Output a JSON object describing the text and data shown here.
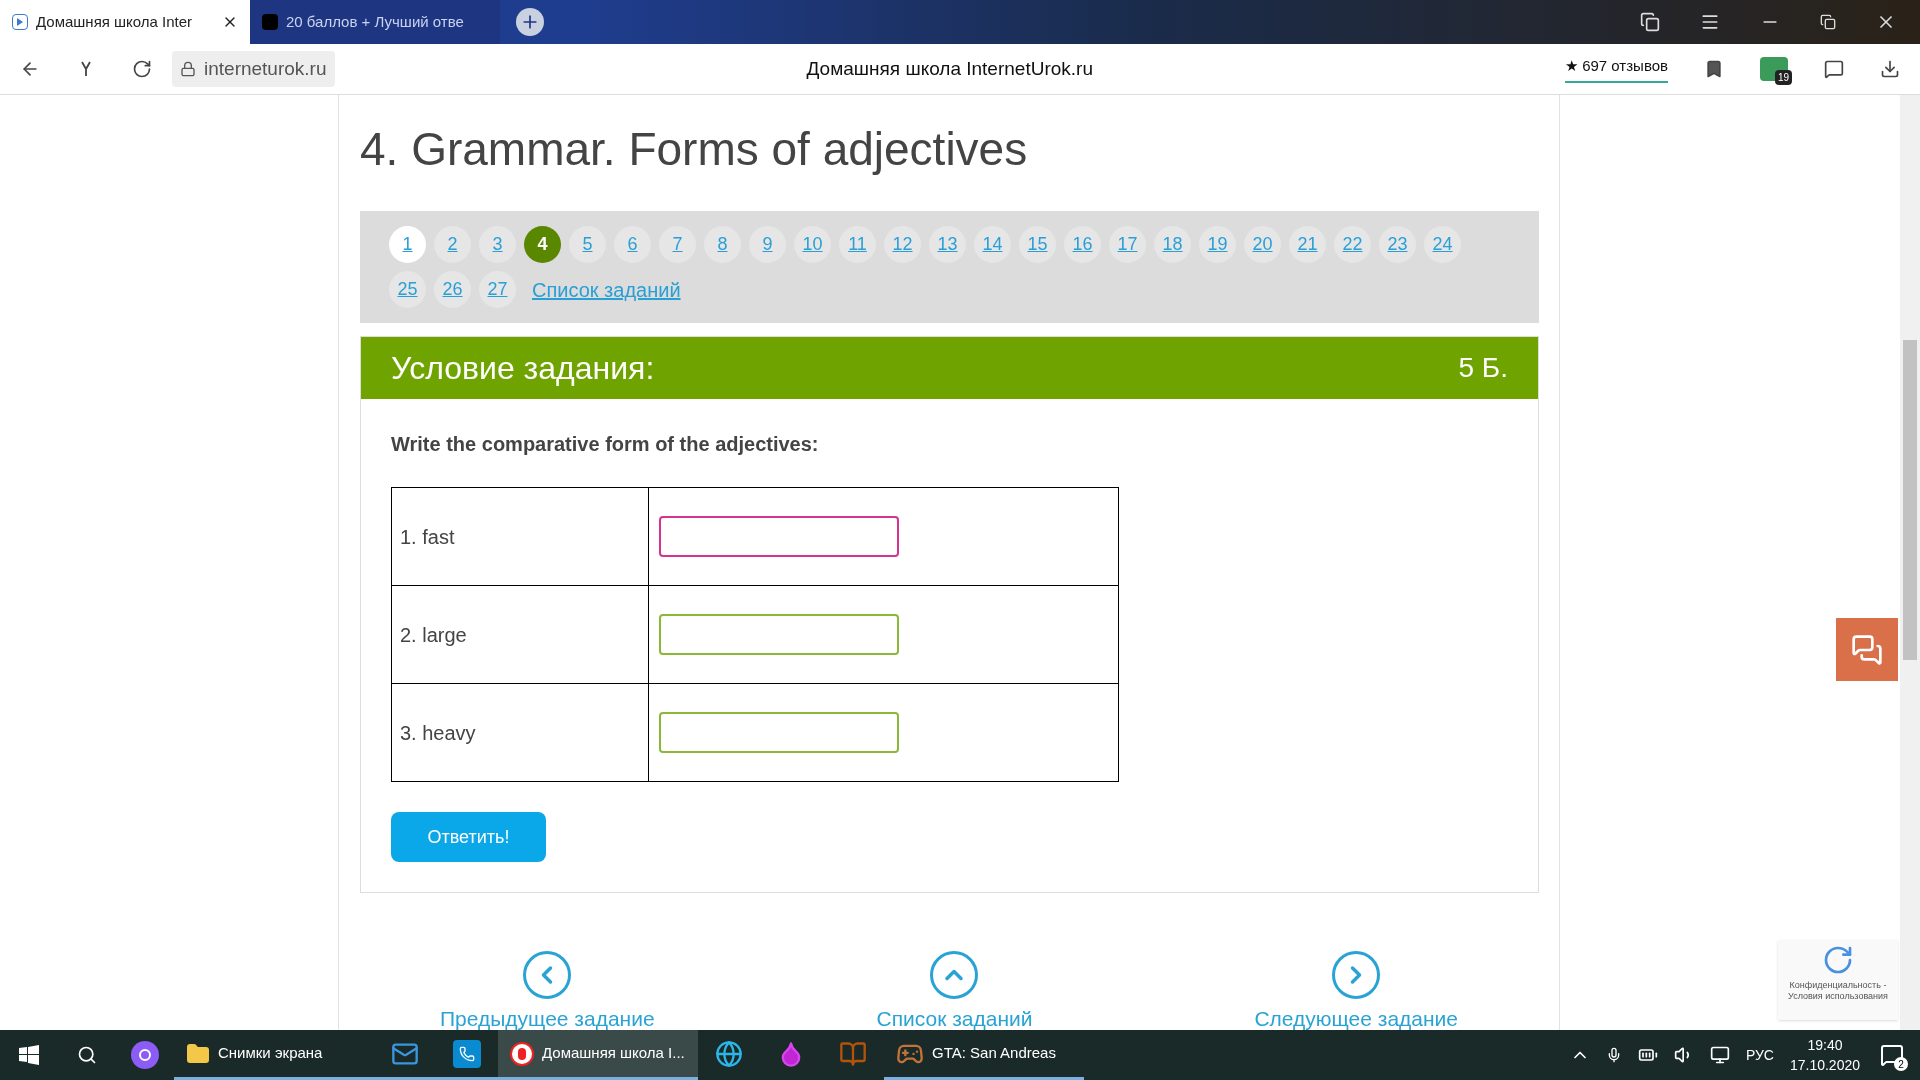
{
  "browser": {
    "tabs": [
      {
        "title": "Домашняя школа Inter",
        "selected": true
      },
      {
        "title": "20 баллов + Лучший отве",
        "selected": false
      }
    ],
    "address": {
      "url": "interneturok.ru",
      "page_title": "Домашняя школа InternetUrok.ru",
      "rating": "★ 697 отзывов",
      "extension_badge": "19"
    }
  },
  "page": {
    "title": "4. Grammar. Forms of adjectives",
    "pager": {
      "items": [
        {
          "label": "1",
          "selected": false,
          "visited": true
        },
        {
          "label": "2",
          "selected": false,
          "visited": false
        },
        {
          "label": "3",
          "selected": false,
          "visited": false
        },
        {
          "label": "4",
          "selected": true,
          "visited": false
        },
        {
          "label": "5",
          "selected": false,
          "visited": false
        },
        {
          "label": "6",
          "selected": false,
          "visited": false
        },
        {
          "label": "7",
          "selected": false,
          "visited": false
        },
        {
          "label": "8",
          "selected": false,
          "visited": false
        },
        {
          "label": "9",
          "selected": false,
          "visited": false
        },
        {
          "label": "10",
          "selected": false,
          "visited": false
        },
        {
          "label": "11",
          "selected": false,
          "visited": false
        },
        {
          "label": "12",
          "selected": false,
          "visited": false
        },
        {
          "label": "13",
          "selected": false,
          "visited": false
        },
        {
          "label": "14",
          "selected": false,
          "visited": false
        },
        {
          "label": "15",
          "selected": false,
          "visited": false
        },
        {
          "label": "16",
          "selected": false,
          "visited": false
        },
        {
          "label": "17",
          "selected": false,
          "visited": false
        },
        {
          "label": "18",
          "selected": false,
          "visited": false
        },
        {
          "label": "19",
          "selected": false,
          "visited": false
        },
        {
          "label": "20",
          "selected": false,
          "visited": false
        },
        {
          "label": "21",
          "selected": false,
          "visited": false
        },
        {
          "label": "22",
          "selected": false,
          "visited": false
        },
        {
          "label": "23",
          "selected": false,
          "visited": false
        },
        {
          "label": "24",
          "selected": false,
          "visited": false
        },
        {
          "label": "25",
          "selected": false,
          "visited": false
        },
        {
          "label": "26",
          "selected": false,
          "visited": false
        },
        {
          "label": "27",
          "selected": false,
          "visited": false
        }
      ],
      "list_link": "Список заданий"
    },
    "task": {
      "header": "Условие задания:",
      "points": "5 Б.",
      "instruction": "Write the comparative form of the adjectives:",
      "rows": [
        {
          "label": "1. fast",
          "focused": true
        },
        {
          "label": "2. large",
          "focused": false
        },
        {
          "label": "3. heavy",
          "focused": false
        }
      ],
      "submit": "Ответить!"
    },
    "nav": [
      {
        "kind": "prev",
        "label": "Предыдущее задание"
      },
      {
        "kind": "up",
        "label": "Список заданий"
      },
      {
        "kind": "next",
        "label": "Следующее задание"
      }
    ],
    "recaptcha": {
      "line_1": "Конфиденциальность -",
      "line_2": "Условия использования"
    }
  },
  "taskbar": {
    "items": [
      {
        "kind": "folder",
        "label": "Снимки экрана",
        "selected": false,
        "running": true
      },
      {
        "kind": "mail",
        "selected": false,
        "running": true
      },
      {
        "kind": "whatsapp",
        "selected": false,
        "running": true
      },
      {
        "kind": "browser",
        "label": "Домашняя школа I...",
        "selected": true,
        "running": true
      },
      {
        "kind": "edge",
        "selected": false,
        "running": false
      },
      {
        "kind": "paint",
        "selected": false,
        "running": false
      },
      {
        "kind": "book",
        "selected": false,
        "running": false
      },
      {
        "kind": "game",
        "label": "GTA: San Andreas",
        "selected": false,
        "running": true
      }
    ],
    "language": "РУС",
    "time": "19:40",
    "date": "17.10.2020",
    "notifications": "2"
  }
}
